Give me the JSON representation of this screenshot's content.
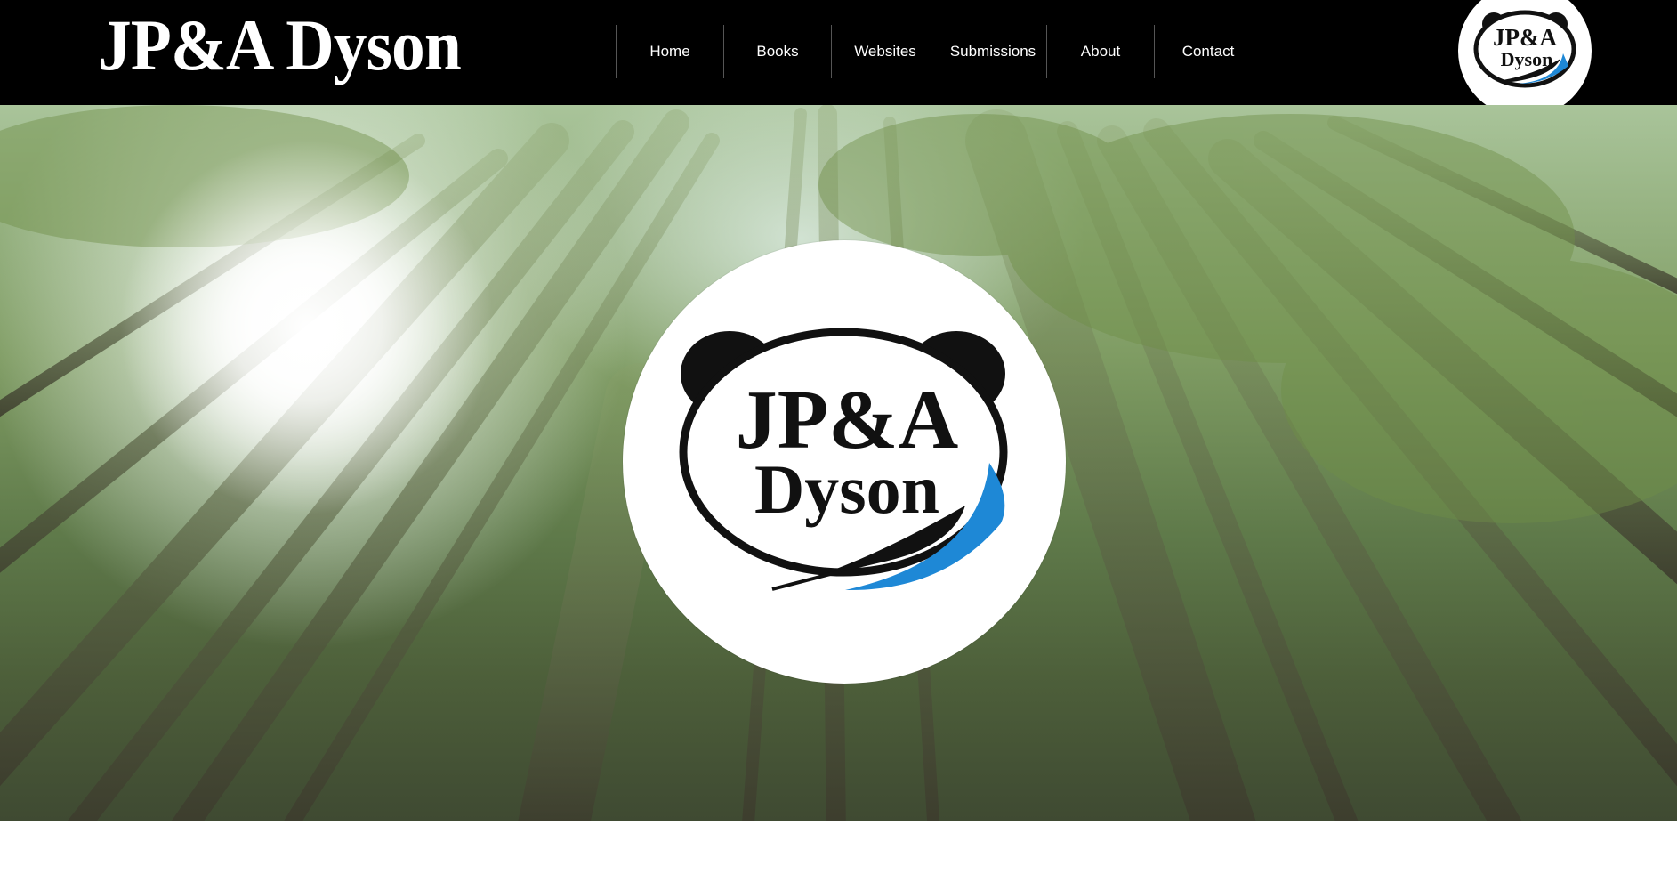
{
  "header": {
    "site_title": "JP&A Dyson",
    "nav": [
      {
        "label": "Home"
      },
      {
        "label": "Books"
      },
      {
        "label": "Websites"
      },
      {
        "label": "Submissions"
      },
      {
        "label": "About"
      },
      {
        "label": "Contact"
      }
    ],
    "badge_logo": {
      "line1": "JP&A",
      "line2": "Dyson"
    }
  },
  "hero": {
    "background": "bamboo-forest-image",
    "logo": {
      "line1": "JP&A",
      "line2": "Dyson",
      "icon": "panda-logo-icon"
    }
  },
  "colors": {
    "header_bg": "#000000",
    "accent_blue": "#1e88d6",
    "logo_black": "#111111"
  }
}
